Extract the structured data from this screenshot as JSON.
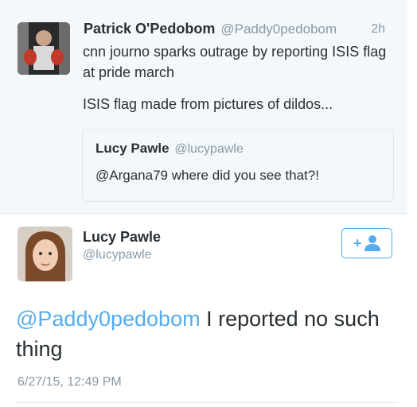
{
  "quoted_tweet": {
    "name": "Patrick O'Pedobom",
    "handle": "@Paddy0pedobom",
    "time": "2h",
    "text_line1": "cnn journo sparks outrage by reporting ISIS flag at pride march",
    "text_line2": "ISIS flag made from pictures of dildos...",
    "embedded": {
      "name": "Lucy Pawle",
      "handle": "@lucypawle",
      "text": "@Argana79 where did you see that?!"
    }
  },
  "main_tweet": {
    "name": "Lucy Pawle",
    "handle": "@lucypawle",
    "mention": "@Paddy0pedobom",
    "text": " I reported no such thing",
    "timestamp": "6/27/15, 12:49 PM",
    "follow_icon": "add-user-icon"
  },
  "colors": {
    "accent": "#55acee",
    "muted": "#8899a6",
    "text": "#292f33",
    "quoted_bg": "#f5f8fa",
    "border": "#e1e8ed"
  }
}
